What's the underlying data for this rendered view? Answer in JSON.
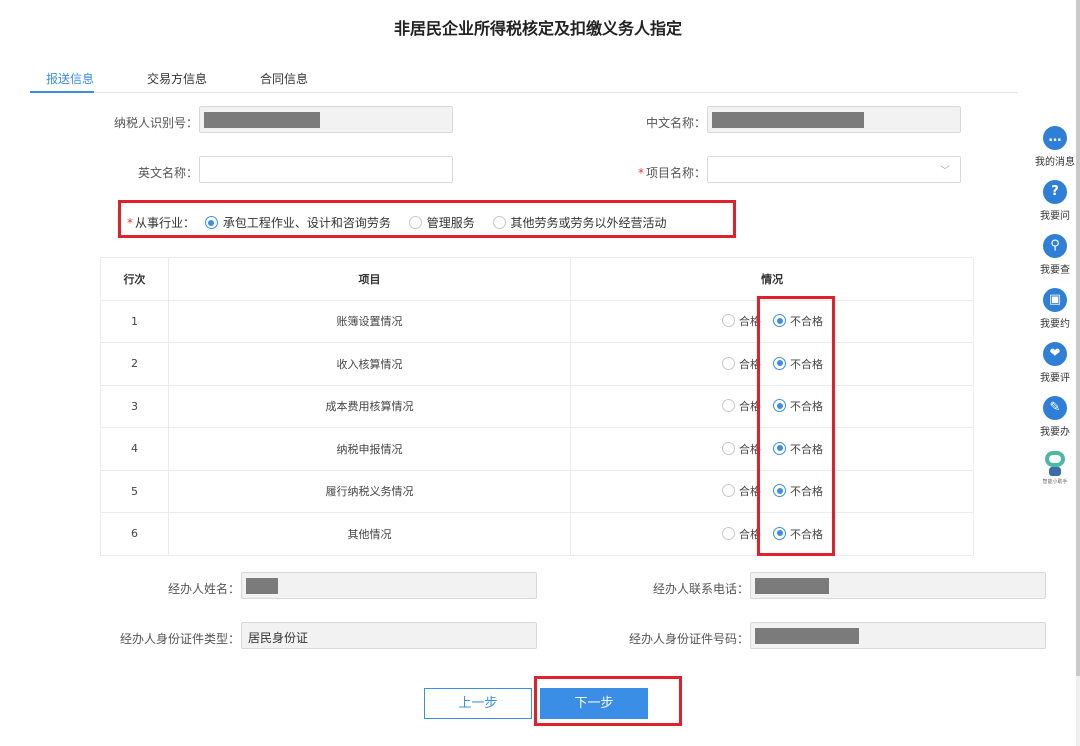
{
  "page": {
    "title": "非居民企业所得税核定及扣缴义务人指定"
  },
  "tabs": [
    {
      "label": "报送信息",
      "active": true
    },
    {
      "label": "交易方信息",
      "active": false
    },
    {
      "label": "合同信息",
      "active": false
    }
  ],
  "form": {
    "taxpayer_id": {
      "label": "纳税人识别号：",
      "value": ""
    },
    "cn_name": {
      "label": "中文名称：",
      "value": ""
    },
    "en_name": {
      "label": "英文名称：",
      "value": ""
    },
    "project_name": {
      "label": "项目名称：",
      "value": "",
      "required": "*"
    },
    "industry": {
      "label": "从事行业：",
      "required": "*",
      "options": [
        "承包工程作业、设计和咨询劳务",
        "管理服务",
        "其他劳务或劳务以外经营活动"
      ],
      "selected_index": 0
    }
  },
  "table": {
    "headers": [
      "行次",
      "项目",
      "情况"
    ],
    "status_options": [
      "合格",
      "不合格"
    ],
    "rows": [
      {
        "no": "1",
        "item": "账簿设置情况",
        "selected": "不合格"
      },
      {
        "no": "2",
        "item": "收入核算情况",
        "selected": "不合格"
      },
      {
        "no": "3",
        "item": "成本费用核算情况",
        "selected": "不合格"
      },
      {
        "no": "4",
        "item": "纳税申报情况",
        "selected": "不合格"
      },
      {
        "no": "5",
        "item": "履行纳税义务情况",
        "selected": "不合格"
      },
      {
        "no": "6",
        "item": "其他情况",
        "selected": "不合格"
      }
    ]
  },
  "agent": {
    "name_label": "经办人姓名：",
    "phone_label": "经办人联系电话：",
    "id_type_label": "经办人身份证件类型：",
    "id_type_value": "居民身份证",
    "id_no_label": "经办人身份证件号码："
  },
  "buttons": {
    "prev": "上一步",
    "next": "下一步"
  },
  "sidebar": [
    {
      "label": "我的消息",
      "icon": "message-icon",
      "glyph": "…"
    },
    {
      "label": "我要问",
      "icon": "question-icon",
      "glyph": "?"
    },
    {
      "label": "我要查",
      "icon": "search-icon",
      "glyph": "⚲"
    },
    {
      "label": "我要约",
      "icon": "calendar-icon",
      "glyph": "▣"
    },
    {
      "label": "我要评",
      "icon": "rating-icon",
      "glyph": "❤"
    },
    {
      "label": "我要办",
      "icon": "edit-icon",
      "glyph": "✎"
    }
  ],
  "assistant": {
    "label": "智能小助手",
    "icon": "robot-icon"
  },
  "colors": {
    "accent": "#3a8ee6",
    "highlight": "#e0202a",
    "sidebar_icon": "#2f7fd6"
  }
}
